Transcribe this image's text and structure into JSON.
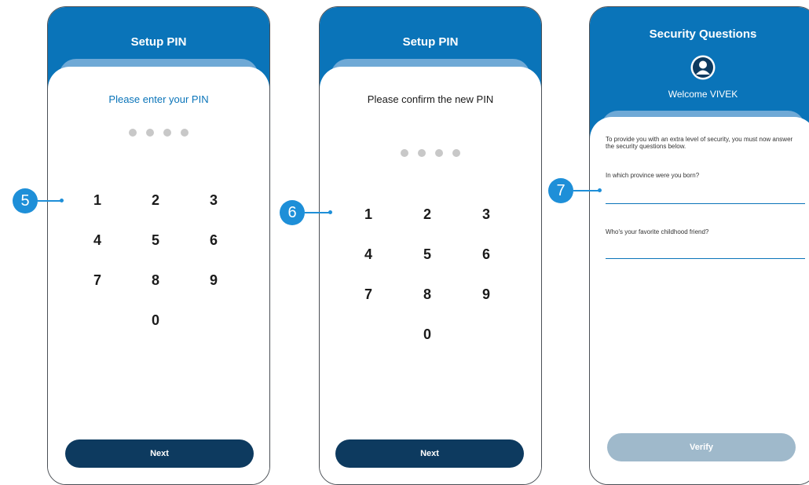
{
  "screens": [
    {
      "title": "Setup PIN",
      "prompt": "Please enter your PIN",
      "keys": [
        "1",
        "2",
        "3",
        "4",
        "5",
        "6",
        "7",
        "8",
        "9",
        "0"
      ],
      "button": "Next",
      "callout": "5"
    },
    {
      "title": "Setup PIN",
      "prompt": "Please confirm the new PIN",
      "keys": [
        "1",
        "2",
        "3",
        "4",
        "5",
        "6",
        "7",
        "8",
        "9",
        "0"
      ],
      "button": "Next",
      "callout": "6"
    },
    {
      "title": "Security Questions",
      "welcome": "Welcome VIVEK",
      "intro": "To provide you with an extra level of security, you must now answer the security questions below.",
      "question1": "In which province were you born?",
      "question2": "Who's your favorite childhood friend?",
      "button": "Verify",
      "callout": "7"
    }
  ],
  "colors": {
    "header": "#0a74b9",
    "primary_button": "#0d3a5f",
    "disabled_button": "#9fb9cb",
    "callout": "#1e8fd8"
  }
}
